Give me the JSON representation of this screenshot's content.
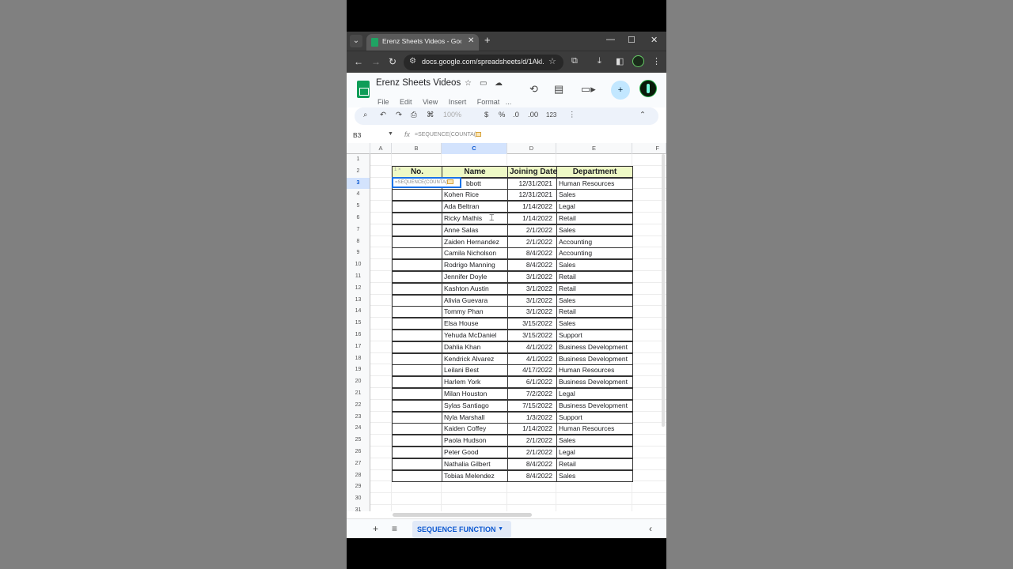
{
  "browser": {
    "tab_title": "Erenz Sheets Videos - Google S",
    "tab_dropdown": "⌄",
    "tab_close": "✕",
    "new_tab": "+",
    "minimize": "—",
    "maximize": "☐",
    "close": "✕",
    "url": "docs.google.com/spreadsheets/d/1Akl...",
    "back": "←",
    "forward": "→",
    "reload": "↻"
  },
  "doc": {
    "title": "Erenz Sheets Videos",
    "menus": [
      "File",
      "Edit",
      "View",
      "Insert",
      "Format",
      "..."
    ]
  },
  "toolbar": {
    "zoom": "100%",
    "currency": "$",
    "percent": "%",
    "dec_decrease": ".0",
    "dec_increase": ".00",
    "number_format": "123"
  },
  "formula_bar": {
    "cell_ref": "B3",
    "formula": "=SEQUENCE(COUNTA("
  },
  "grid": {
    "columns": [
      "A",
      "B",
      "C",
      "D",
      "E",
      "F"
    ],
    "rows": [
      "1",
      "2",
      "3",
      "4",
      "5",
      "6",
      "7",
      "8",
      "9",
      "10",
      "11",
      "12",
      "13",
      "14",
      "15",
      "16",
      "17",
      "18",
      "19",
      "20",
      "21",
      "22",
      "23",
      "24",
      "25",
      "26",
      "27",
      "28",
      "29",
      "30",
      "31"
    ],
    "table_headers": [
      "No.",
      "Name",
      "Joining Date",
      "Department"
    ],
    "edit_cell_text": "=SEQUENCE(COUNTA(",
    "suggestion_hint": "1 ×",
    "records": [
      [
        "bbott",
        "12/31/2021",
        "Human Resources"
      ],
      [
        "Kohen Rice",
        "12/31/2021",
        "Sales"
      ],
      [
        "Ada Beltran",
        "1/14/2022",
        "Legal"
      ],
      [
        "Ricky Mathis",
        "1/14/2022",
        "Retail"
      ],
      [
        "Anne Salas",
        "2/1/2022",
        "Sales"
      ],
      [
        "Zaiden Hernandez",
        "2/1/2022",
        "Accounting"
      ],
      [
        "Camila Nicholson",
        "8/4/2022",
        "Accounting"
      ],
      [
        "Rodrigo Manning",
        "8/4/2022",
        "Sales"
      ],
      [
        "Jennifer Doyle",
        "3/1/2022",
        "Retail"
      ],
      [
        "Kashton Austin",
        "3/1/2022",
        "Retail"
      ],
      [
        "Alivia Guevara",
        "3/1/2022",
        "Sales"
      ],
      [
        "Tommy Phan",
        "3/1/2022",
        "Retail"
      ],
      [
        "Elsa House",
        "3/15/2022",
        "Sales"
      ],
      [
        "Yehuda McDaniel",
        "3/15/2022",
        "Support"
      ],
      [
        "Dahlia Khan",
        "4/1/2022",
        "Business Development"
      ],
      [
        "Kendrick Alvarez",
        "4/1/2022",
        "Business Development"
      ],
      [
        "Leilani Best",
        "4/17/2022",
        "Human Resources"
      ],
      [
        "Harlem York",
        "6/1/2022",
        "Business Development"
      ],
      [
        "Milan Houston",
        "7/2/2022",
        "Legal"
      ],
      [
        "Sylas Santiago",
        "7/15/2022",
        "Business Development"
      ],
      [
        "Nyla Marshall",
        "1/3/2022",
        "Support"
      ],
      [
        "Kaiden Coffey",
        "1/14/2022",
        "Human Resources"
      ],
      [
        "Paola Hudson",
        "2/1/2022",
        "Sales"
      ],
      [
        "Peter Good",
        "2/1/2022",
        "Legal"
      ],
      [
        "Nathalia Gilbert",
        "8/4/2022",
        "Retail"
      ],
      [
        "Tobias Melendez",
        "8/4/2022",
        "Sales"
      ]
    ]
  },
  "sheets": {
    "add": "+",
    "all_sheets": "≡",
    "active_tab": "SEQUENCE FUNCTION",
    "collapse": "‹"
  },
  "colors": {
    "header_fill": "#eef9c6",
    "selection_blue": "#1a73e8",
    "sheets_green": "#0f9d58"
  }
}
